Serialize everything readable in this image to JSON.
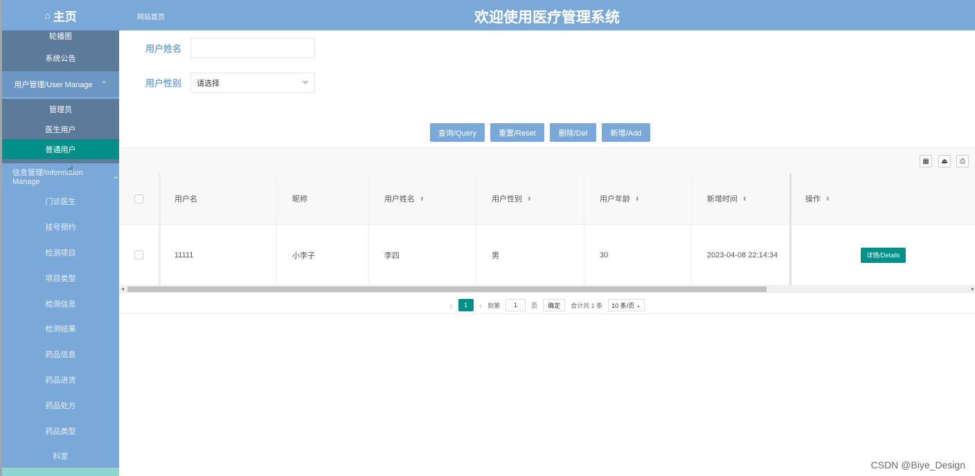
{
  "sidebar": {
    "brand": "主页",
    "top_items": [
      "轮播图",
      "系统公告"
    ],
    "user_group": "用户管理/User Manage",
    "user_items": [
      "管理员",
      "医生用户",
      "普通用户"
    ],
    "active_item": "普通用户",
    "info_group": "信息管理/Information Manage",
    "info_items": [
      "门诊医生",
      "挂号预约",
      "检测项目",
      "项目类型",
      "检测信息",
      "检测结果",
      "药品信息",
      "药品进货",
      "药品处方",
      "药品类型",
      "科室"
    ]
  },
  "header": {
    "home_link": "网站首页",
    "title": "欢迎使用医疗管理系统"
  },
  "search": {
    "name_label": "用户姓名",
    "name_value": "",
    "gender_label": "用户性别",
    "gender_value": "请选择"
  },
  "buttons": {
    "query": "查询/Query",
    "reset": "重置/Reset",
    "delete": "删除/Del",
    "add": "新增/Add"
  },
  "table": {
    "columns": [
      "用户名",
      "昵称",
      "用户姓名",
      "用户性别",
      "用户年龄",
      "新增时间",
      "操作"
    ],
    "rows": [
      {
        "username": "11111",
        "nickname": "小李子",
        "realname": "李四",
        "gender": "男",
        "age": "30",
        "created": "2023-04-08 22:14:34",
        "action": "详情/Details"
      }
    ]
  },
  "pager": {
    "current": "1",
    "goto_label": "到第",
    "page_input": "1",
    "page_unit": "页",
    "confirm": "确定",
    "total": "合计共 1 条",
    "page_size": "10 条/页"
  },
  "watermark": "CSDN @Biye_Design",
  "colors": {
    "primary": "#7aa9d9",
    "accent": "#00908a",
    "sidebar_sub": "#5c7a9a"
  }
}
